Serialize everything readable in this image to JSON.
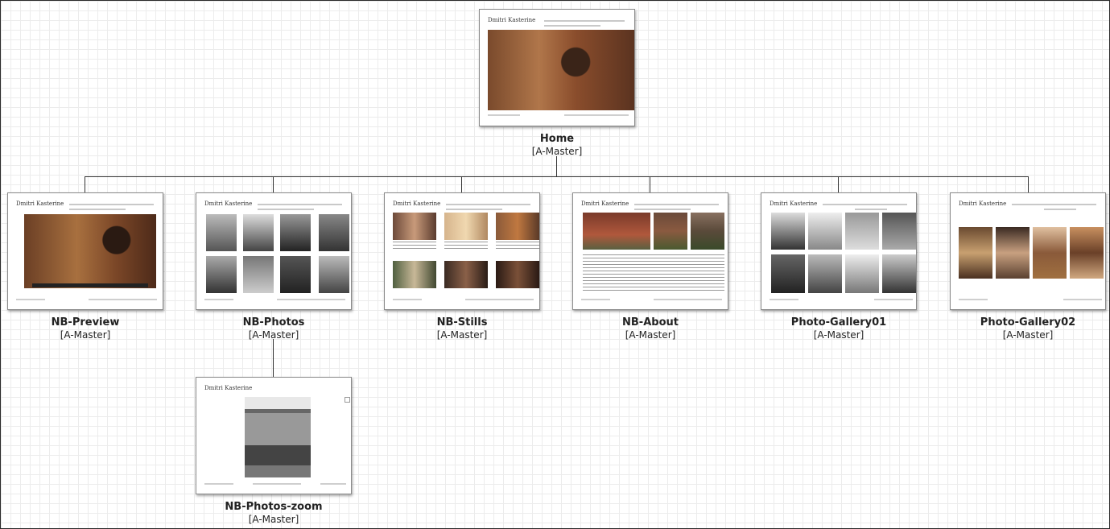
{
  "sitemap": {
    "home": {
      "name": "Home",
      "master": "[A-Master]"
    },
    "children": [
      {
        "name": "NB-Preview",
        "master": "[A-Master]"
      },
      {
        "name": "NB-Photos",
        "master": "[A-Master]"
      },
      {
        "name": "NB-Stills",
        "master": "[A-Master]"
      },
      {
        "name": "NB-About",
        "master": "[A-Master]"
      },
      {
        "name": "Photo-Gallery01",
        "master": "[A-Master]"
      },
      {
        "name": "Photo-Gallery02",
        "master": "[A-Master]"
      }
    ],
    "grandchild": {
      "name": "NB-Photos-zoom",
      "master": "[A-Master]"
    }
  },
  "thumb_logo": "Dmitri Kasterine",
  "colors": {
    "connector": "#333333",
    "grid": "#ececec",
    "border": "#2a2a2a"
  }
}
